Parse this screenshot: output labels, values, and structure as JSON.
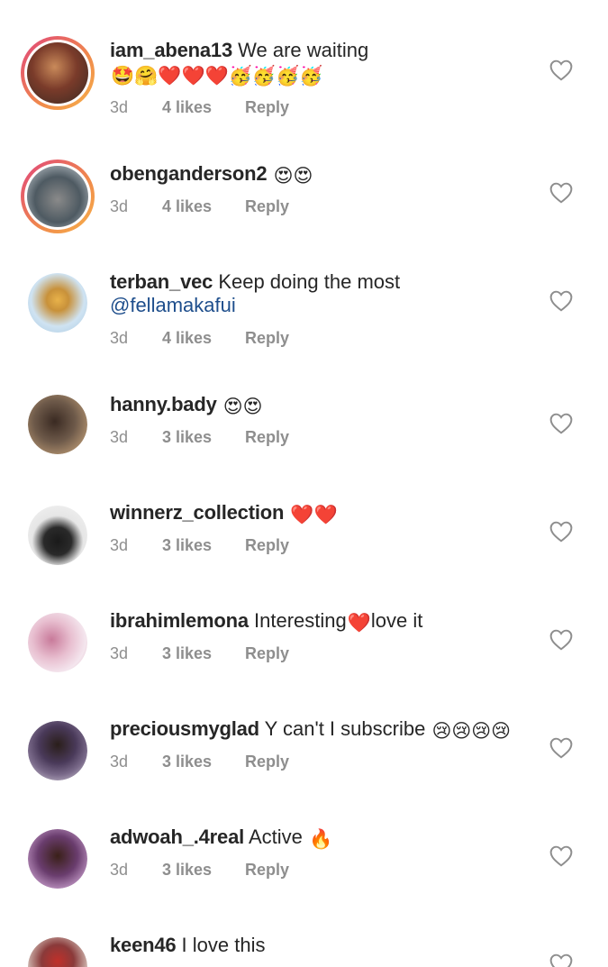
{
  "comments": [
    {
      "username": "iam_abena13",
      "text": "We are waiting",
      "mention": "",
      "emoji": "🤩🤗❤️❤️❤️🥳🥳🥳🥳",
      "time": "3d",
      "likes": "4 likes",
      "reply": "Reply",
      "story": true,
      "avatar_color": "#6b3a2a"
    },
    {
      "username": "obenganderson2",
      "text": "",
      "mention": "",
      "emoji": "😍😍",
      "time": "3d",
      "likes": "4 likes",
      "reply": "Reply",
      "story": true,
      "avatar_color": "#5a6b7a"
    },
    {
      "username": "terban_vec",
      "text": "Keep doing the most",
      "mention": "@fellamakafui",
      "emoji": "",
      "time": "3d",
      "likes": "4 likes",
      "reply": "Reply",
      "story": false,
      "avatar_color": "#b7d3e8"
    },
    {
      "username": "hanny.bady",
      "text": "",
      "mention": "",
      "emoji": "😍😍",
      "time": "3d",
      "likes": "3 likes",
      "reply": "Reply",
      "story": false,
      "avatar_color": "#6e5a4a"
    },
    {
      "username": "winnerz_collection",
      "text": "",
      "mention": "",
      "emoji": "❤️❤️",
      "time": "3d",
      "likes": "3 likes",
      "reply": "Reply",
      "story": false,
      "avatar_color": "#d8d8d8"
    },
    {
      "username": "ibrahimlemona",
      "text": "Interesting",
      "mention": "",
      "emoji": "❤️",
      "text_after": "love it",
      "time": "3d",
      "likes": "3 likes",
      "reply": "Reply",
      "story": false,
      "avatar_color": "#d9a8b8"
    },
    {
      "username": "preciousmyglad",
      "text": "Y can't I subscribe",
      "mention": "",
      "emoji": "😢😢😢😢",
      "time": "3d",
      "likes": "3 likes",
      "reply": "Reply",
      "story": false,
      "avatar_color": "#4a3a5a"
    },
    {
      "username": "adwoah_.4real",
      "text": "Active",
      "mention": "",
      "emoji": "🔥",
      "time": "3d",
      "likes": "3 likes",
      "reply": "Reply",
      "story": false,
      "avatar_color": "#6a3d6e"
    },
    {
      "username": "keen46",
      "text": "I love this",
      "mention": "",
      "emoji": "",
      "time": "",
      "likes": "",
      "reply": "",
      "story": false,
      "avatar_color": "#8a3a3a"
    }
  ],
  "colors": {
    "heart_outline": "#8e8e8e",
    "mention": "#1e4e8c",
    "meta": "#8e8e8e"
  },
  "icons": {
    "like": "heart-outline-icon"
  }
}
